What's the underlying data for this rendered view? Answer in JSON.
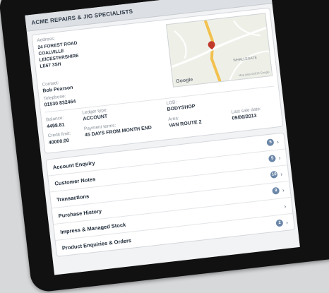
{
  "app": {
    "title": "ACME REPAIRS & JIG SPECIALISTS"
  },
  "customer": {
    "address_label": "Address:",
    "address_lines": [
      "24 FOREST ROAD",
      "COALVILLE",
      "LEICESTERSHIRE",
      "LE67 3SH"
    ],
    "contact_label": "Contact:",
    "contact_value": "Bob Pearson",
    "telephone_label": "Telephone:",
    "telephone_value": "01530 832464"
  },
  "account": {
    "balance_label": "Balance:",
    "balance_value": "4498.81",
    "credit_limit_label": "Credit limit:",
    "credit_limit_value": "40000.00",
    "ledger_type_label": "Ledger type:",
    "ledger_type_value": "ACCOUNT",
    "payment_terms_label": "Payment terms:",
    "payment_terms_value": "45 DAYS FROM MONTH END",
    "lob_label": "LOB:",
    "lob_value": "BODYSHOP",
    "area_label": "Area:",
    "area_value": "VAN ROUTE 2",
    "last_sale_label": "Last sale date:",
    "last_sale_value": "09/06/2013"
  },
  "map": {
    "google_label": "Google",
    "data_label": "Map data ©2013 Google",
    "place_label": "WHALLEGATE"
  },
  "menu": {
    "items": [
      {
        "label": "Account Enquiry",
        "badge": "5"
      },
      {
        "label": "Customer Notes",
        "badge": "5"
      },
      {
        "label": "Transactions",
        "badge": "10"
      },
      {
        "label": "Purchase History",
        "badge": "9"
      },
      {
        "label": "Impress & Managed Stock",
        "badge": ""
      },
      {
        "label": "Product Enquiries & Orders",
        "badge": "2"
      }
    ]
  },
  "colors": {
    "accent": "#6a86a8",
    "pin": "#c0392b",
    "road": "#f2c14e"
  }
}
